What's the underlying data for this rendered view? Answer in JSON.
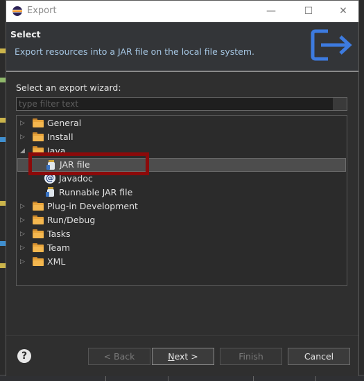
{
  "window": {
    "title": "Export"
  },
  "header": {
    "title": "Select",
    "description": "Export resources into a JAR file on the local file system."
  },
  "wizard": {
    "label": "Select an export wizard:",
    "filter_placeholder": "type filter text",
    "tree": [
      {
        "label": "General",
        "icon": "folder-icon",
        "expanded": false
      },
      {
        "label": "Install",
        "icon": "folder-icon",
        "expanded": false
      },
      {
        "label": "Java",
        "icon": "folder-icon",
        "expanded": true
      },
      {
        "label": "JAR file",
        "icon": "jar-icon",
        "selected": true
      },
      {
        "label": "Javadoc",
        "icon": "javadoc-icon"
      },
      {
        "label": "Runnable JAR file",
        "icon": "jar-icon"
      },
      {
        "label": "Plug-in Development",
        "icon": "folder-icon",
        "expanded": false
      },
      {
        "label": "Run/Debug",
        "icon": "folder-icon",
        "expanded": false
      },
      {
        "label": "Tasks",
        "icon": "folder-icon",
        "expanded": false
      },
      {
        "label": "Team",
        "icon": "folder-icon",
        "expanded": false
      },
      {
        "label": "XML",
        "icon": "folder-icon",
        "expanded": false
      }
    ]
  },
  "buttons": {
    "back": "< Back",
    "next_underlined": "N",
    "next_rest": "ext >",
    "finish": "Finish",
    "cancel": "Cancel"
  },
  "colors": {
    "accent": "#3d7be0",
    "highlight_box": "#8b0a0a",
    "description": "#a6c7e4"
  }
}
